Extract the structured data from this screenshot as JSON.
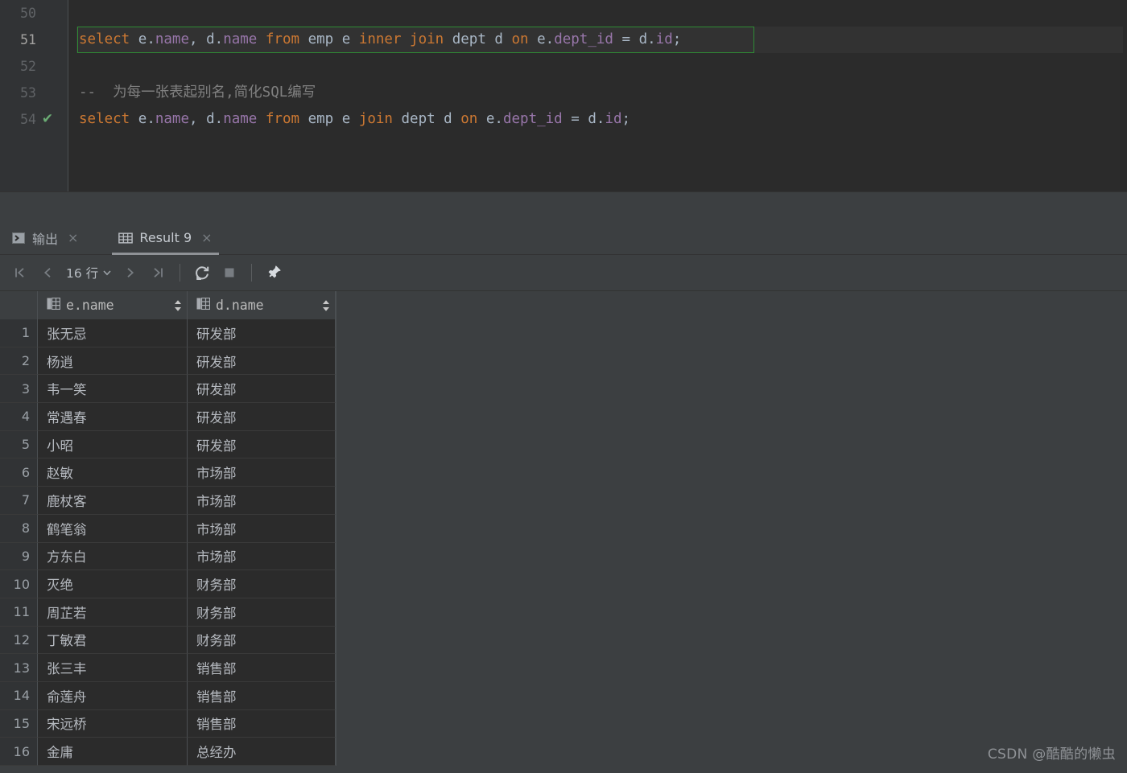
{
  "editor": {
    "lines": [
      {
        "number": "50",
        "status": "",
        "tokens": [],
        "highlighted": false
      },
      {
        "number": "51",
        "status": "",
        "highlighted": true,
        "tokens": [
          {
            "t": "select",
            "c": "kw"
          },
          {
            "t": " ",
            "c": "op"
          },
          {
            "t": "e",
            "c": "id"
          },
          {
            "t": ".",
            "c": "op"
          },
          {
            "t": "name",
            "c": "fld"
          },
          {
            "t": ", ",
            "c": "op"
          },
          {
            "t": "d",
            "c": "id"
          },
          {
            "t": ".",
            "c": "op"
          },
          {
            "t": "name",
            "c": "fld"
          },
          {
            "t": " ",
            "c": "op"
          },
          {
            "t": "from",
            "c": "kw"
          },
          {
            "t": " emp e ",
            "c": "id"
          },
          {
            "t": "inner",
            "c": "kw"
          },
          {
            "t": " ",
            "c": "op"
          },
          {
            "t": "join",
            "c": "kw"
          },
          {
            "t": " dept d ",
            "c": "id"
          },
          {
            "t": "on",
            "c": "kw"
          },
          {
            "t": " e",
            "c": "id"
          },
          {
            "t": ".",
            "c": "op"
          },
          {
            "t": "dept_id",
            "c": "fld"
          },
          {
            "t": " = d",
            "c": "id"
          },
          {
            "t": ".",
            "c": "op"
          },
          {
            "t": "id",
            "c": "fld"
          },
          {
            "t": ";",
            "c": "op"
          }
        ]
      },
      {
        "number": "52",
        "status": "",
        "tokens": [],
        "highlighted": false
      },
      {
        "number": "53",
        "status": "",
        "highlighted": false,
        "tokens": [
          {
            "t": "--  为每一张表起别名,简化SQL编写",
            "c": "cmt"
          }
        ]
      },
      {
        "number": "54",
        "status": "check",
        "highlighted": false,
        "tokens": [
          {
            "t": "select",
            "c": "kw"
          },
          {
            "t": " ",
            "c": "op"
          },
          {
            "t": "e",
            "c": "id"
          },
          {
            "t": ".",
            "c": "op"
          },
          {
            "t": "name",
            "c": "fld"
          },
          {
            "t": ", ",
            "c": "op"
          },
          {
            "t": "d",
            "c": "id"
          },
          {
            "t": ".",
            "c": "op"
          },
          {
            "t": "name",
            "c": "fld"
          },
          {
            "t": " ",
            "c": "op"
          },
          {
            "t": "from",
            "c": "kw"
          },
          {
            "t": " emp e ",
            "c": "id"
          },
          {
            "t": "join",
            "c": "kw"
          },
          {
            "t": " dept d ",
            "c": "id"
          },
          {
            "t": "on",
            "c": "kw"
          },
          {
            "t": " e",
            "c": "id"
          },
          {
            "t": ".",
            "c": "op"
          },
          {
            "t": "dept_id",
            "c": "fld"
          },
          {
            "t": " = d",
            "c": "id"
          },
          {
            "t": ".",
            "c": "op"
          },
          {
            "t": "id",
            "c": "fld"
          },
          {
            "t": ";",
            "c": "op"
          }
        ]
      }
    ],
    "selection_border_color": "#2f8c35",
    "check_mark": "✔"
  },
  "panel": {
    "tabs": [
      {
        "id": "output",
        "label": "输出",
        "icon": "console-icon",
        "close": "×",
        "active": false
      },
      {
        "id": "result9",
        "label": "Result 9",
        "icon": "table-icon",
        "close": "×",
        "active": true
      }
    ],
    "toolbar": {
      "first_page": "|<",
      "prev_page": "<",
      "rows_label": "16 行",
      "rows_dropdown": "⌄",
      "next_page": ">",
      "last_page": ">|",
      "reload": "reload-icon",
      "stop": "stop-icon",
      "pin": "pin-icon"
    }
  },
  "grid": {
    "columns": [
      {
        "label": "e.name",
        "icon": "column-icon"
      },
      {
        "label": "d.name",
        "icon": "column-icon"
      }
    ],
    "rows": [
      {
        "n": "1",
        "e_name": "张无忌",
        "d_name": "研发部"
      },
      {
        "n": "2",
        "e_name": "杨逍",
        "d_name": "研发部"
      },
      {
        "n": "3",
        "e_name": "韦一笑",
        "d_name": "研发部"
      },
      {
        "n": "4",
        "e_name": "常遇春",
        "d_name": "研发部"
      },
      {
        "n": "5",
        "e_name": "小昭",
        "d_name": "研发部"
      },
      {
        "n": "6",
        "e_name": "赵敏",
        "d_name": "市场部"
      },
      {
        "n": "7",
        "e_name": "鹿杖客",
        "d_name": "市场部"
      },
      {
        "n": "8",
        "e_name": "鹤笔翁",
        "d_name": "市场部"
      },
      {
        "n": "9",
        "e_name": "方东白",
        "d_name": "市场部"
      },
      {
        "n": "10",
        "e_name": "灭绝",
        "d_name": "财务部"
      },
      {
        "n": "11",
        "e_name": "周芷若",
        "d_name": "财务部"
      },
      {
        "n": "12",
        "e_name": "丁敏君",
        "d_name": "财务部"
      },
      {
        "n": "13",
        "e_name": "张三丰",
        "d_name": "销售部"
      },
      {
        "n": "14",
        "e_name": "俞莲舟",
        "d_name": "销售部"
      },
      {
        "n": "15",
        "e_name": "宋远桥",
        "d_name": "销售部"
      },
      {
        "n": "16",
        "e_name": "金庸",
        "d_name": "总经办"
      }
    ]
  },
  "watermark": {
    "text": "CSDN @酷酷的懒虫"
  },
  "colors": {
    "editor_bg": "#2b2b2b",
    "gutter_bg": "#313335",
    "panel_bg": "#3c3f41",
    "keyword": "#cc7832",
    "field": "#9876aa",
    "identifier": "#a9b7c6",
    "comment": "#808080",
    "selection_border": "#2f8c35",
    "check_green": "#6aab73"
  }
}
